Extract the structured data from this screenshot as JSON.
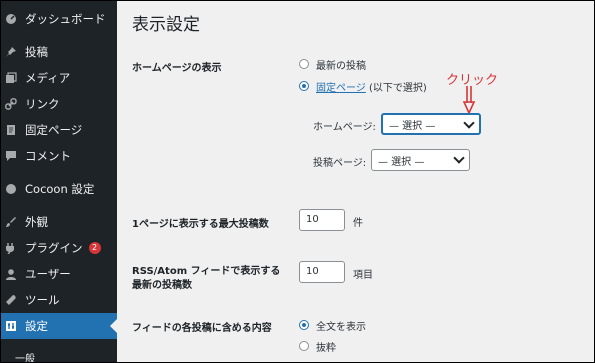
{
  "sidebar": {
    "items": [
      {
        "label": "ダッシュボード",
        "icon": "dashboard-icon"
      },
      {
        "label": "投稿",
        "icon": "pin-icon"
      },
      {
        "label": "メディア",
        "icon": "media-icon"
      },
      {
        "label": "リンク",
        "icon": "link-icon"
      },
      {
        "label": "固定ページ",
        "icon": "page-icon"
      },
      {
        "label": "コメント",
        "icon": "comment-icon"
      },
      {
        "label": "Cocoon 設定",
        "icon": "cocoon-icon"
      },
      {
        "label": "外観",
        "icon": "brush-icon"
      },
      {
        "label": "プラグイン",
        "icon": "plugin-icon",
        "badge": "2"
      },
      {
        "label": "ユーザー",
        "icon": "user-icon"
      },
      {
        "label": "ツール",
        "icon": "tool-icon"
      },
      {
        "label": "設定",
        "icon": "settings-icon"
      }
    ],
    "partial_label": "一般"
  },
  "page": {
    "title": "表示設定",
    "homepage_display_label": "ホームページの表示",
    "option_latest": "最新の投稿",
    "option_static": "固定ページ",
    "option_static_suffix": "(以下で選択)",
    "homepage_select_label": "ホームページ:",
    "homepage_select_value": "— 選択 —",
    "posts_select_label": "投稿ページ:",
    "posts_select_value": "— 選択 —",
    "annotation": "クリック",
    "max_posts_label": "1ページに表示する最大投稿数",
    "max_posts_value": "10",
    "max_posts_unit": "件",
    "rss_label_line1": "RSS/Atom フィードで表示する",
    "rss_label_line2": "最新の投稿数",
    "rss_value": "10",
    "rss_unit": "項目",
    "feed_label": "フィードの各投稿に含める内容",
    "feed_full": "全文を表示",
    "feed_excerpt": "抜粋"
  },
  "colors": {
    "accent": "#2271b1",
    "sidebar": "#1d2327",
    "badge": "#d63638",
    "annotation": "#d63638"
  }
}
